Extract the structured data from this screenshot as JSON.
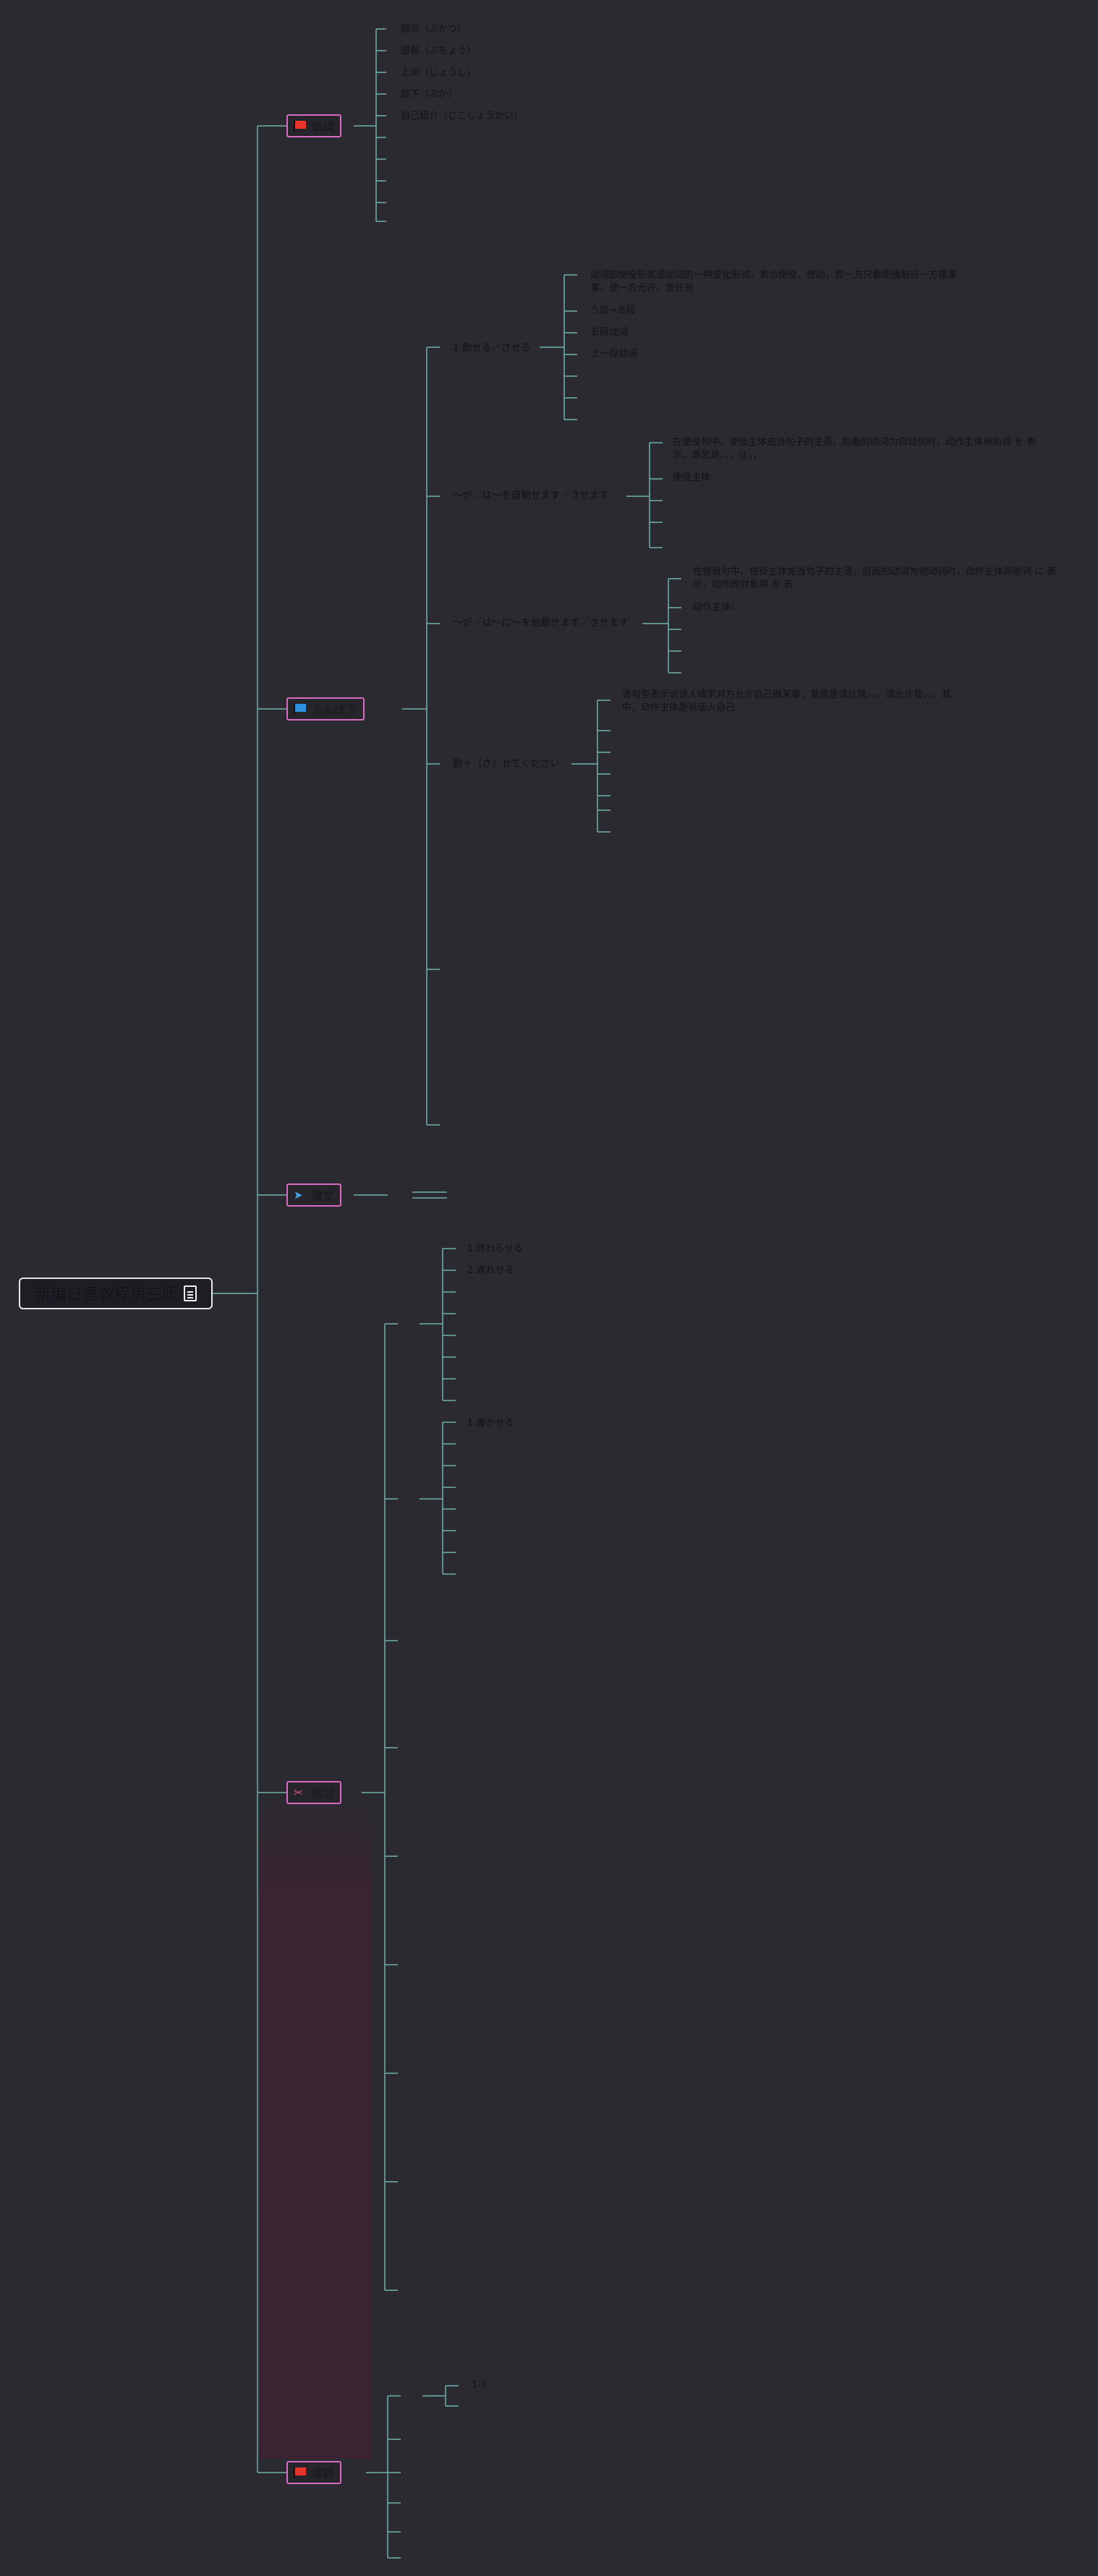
{
  "root": {
    "title": "新编日语教程第三版"
  },
  "branches": [
    {
      "label": "单词",
      "icon": "flag-icon",
      "color": "#e8352c"
    },
    {
      "label": "ぶんぽう",
      "icon": "flag-icon",
      "color": "#2f8fe0"
    },
    {
      "label": "课文",
      "icon": "paper-plane-icon",
      "color": "#4aa6e8"
    },
    {
      "label": "练习",
      "icon": "tools-icon",
      "color": "#e8557a"
    },
    {
      "label": "课题",
      "icon": "flag-icon",
      "color": "#e8352c"
    }
  ],
  "vocab": [
    "部活（ぶかつ）",
    "部長（ぶちょう）",
    "上司（じょうし）",
    "部下（ぶか）",
    "自己紹介（じこしょうかい）"
  ],
  "grammar": {
    "g1": {
      "title": "1.動せる／させる",
      "items": [
        "动词的使役形式是动词的一种变化形式，表示使役、使动，即一方只要能强制另一方做某事，使一方允许、放任另",
        "う段→あ段",
        "五段动词",
        "上一段动词"
      ]
    },
    "g2": {
      "title": "〜が／は〜を自動せます／させます",
      "items": [
        "在使役句中，使役主体充当句子的主语，后面的动词为自动词时，动作主体用助词 を 表示，意思是，，，让，，",
        "使役主体"
      ]
    },
    "g3": {
      "title": "〜が／は〜に〜を他動せます／させます",
      "items": [
        "在使役句中，使役主体充当句子的主语，后面的动词为他动词时，动作主体用助词 に 表示，动作的对象用 を 表",
        "动作主体："
      ]
    },
    "g4": {
      "title": "動＋（さ）せてください",
      "items": [
        "该句型表示说话人请求对方允许自己做某事，意思是请让我，，，请允许我，，，其中，动作主体是说话人自己"
      ]
    }
  },
  "exercise": {
    "e1": [
      "1.終わらせる",
      "2.遅れせる"
    ],
    "e2": [
      "1.書かせる"
    ]
  },
  "topic": {
    "t1": [
      "1-3"
    ]
  }
}
